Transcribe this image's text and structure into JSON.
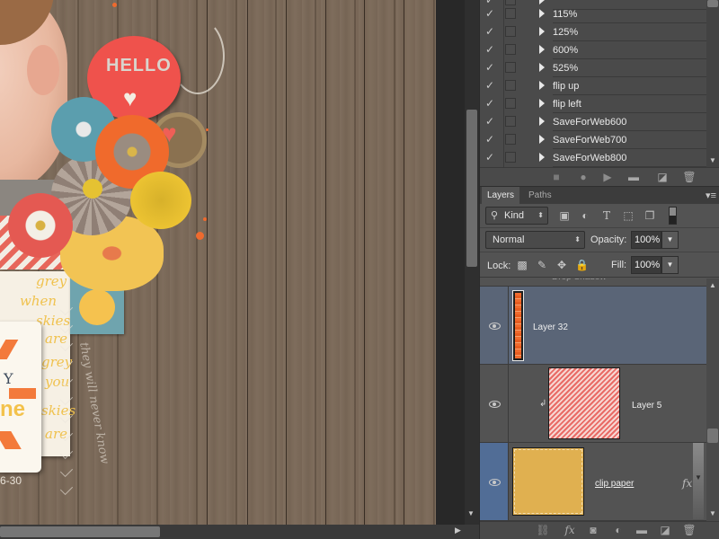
{
  "canvas": {
    "artwork": {
      "badge_text": "HELLO",
      "quote_words": [
        "grey",
        "when",
        "skies",
        "are",
        "grey",
        "you",
        "skies",
        "are"
      ],
      "card_letter": "Y",
      "card_word": "ne",
      "date_text": "6-30",
      "handwriting": "they will never know"
    }
  },
  "actions": {
    "items": [
      {
        "label": "115%",
        "checked": true
      },
      {
        "label": "125%",
        "checked": true
      },
      {
        "label": "600%",
        "checked": true
      },
      {
        "label": "525%",
        "checked": true
      },
      {
        "label": "flip up",
        "checked": true
      },
      {
        "label": "flip left",
        "checked": true
      },
      {
        "label": "SaveForWeb600",
        "checked": true
      },
      {
        "label": "SaveForWeb700",
        "checked": true
      },
      {
        "label": "SaveForWeb800",
        "checked": true
      }
    ],
    "toolbar": {
      "stop": "■",
      "record": "●",
      "play": "▶",
      "new_set": "folder-icon",
      "new_action": "new-icon",
      "delete": "trash-icon"
    }
  },
  "layers_panel": {
    "tabs": [
      {
        "label": "Layers",
        "active": true
      },
      {
        "label": "Paths",
        "active": false
      }
    ],
    "filter": {
      "kind_label": "Kind"
    },
    "blend_mode": "Normal",
    "opacity_label": "Opacity:",
    "opacity_value": "100%",
    "lock_label": "Lock:",
    "fill_label": "Fill:",
    "fill_value": "100%",
    "partial_row_text": "Drop Shadow",
    "layers": [
      {
        "name": "Layer 32",
        "visible": true,
        "selected": true
      },
      {
        "name": "Layer 5",
        "visible": true,
        "clipped": true
      },
      {
        "name": "clip paper",
        "visible": true,
        "has_fx": true,
        "fx_label": "fx"
      }
    ],
    "colors": {
      "selected_row": "#5a6577",
      "clip_paper_fill": "#e0b050",
      "layer5_pattern": "#e96b66",
      "layer32_fill": "#f06b2e"
    }
  }
}
